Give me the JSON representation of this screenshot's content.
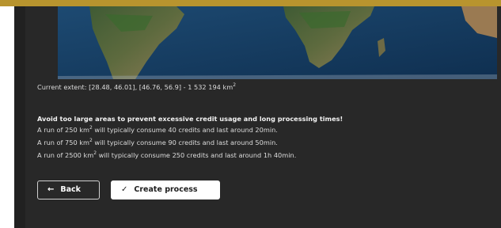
{
  "colors": {
    "accent_bar": "#b8942e",
    "panel_bg": "#282828",
    "text": "#dcdcdc"
  },
  "map": {
    "icon": "satellite-map"
  },
  "extent": {
    "prefix": "Current extent: [28.48, 46.01], [46.76, 56.9] - 1 532 194 km",
    "sup": "2"
  },
  "warning": {
    "title": "Avoid too large areas to prevent excessive credit usage and long processing times!",
    "lines": [
      {
        "pre": "A run of 250 km",
        "sup": "2",
        "post": " will typically consume 40 credits and last around 20min."
      },
      {
        "pre": "A run of 750 km",
        "sup": "2",
        "post": " will typically consume 90 credits and last around 50min."
      },
      {
        "pre": "A run of 2500 km",
        "sup": "2",
        "post": " will typically consume 250 credits and last around 1h 40min."
      }
    ]
  },
  "buttons": {
    "back": {
      "label": "Back",
      "icon": "arrow-left-icon"
    },
    "create": {
      "label": "Create process",
      "icon": "check-icon"
    }
  }
}
